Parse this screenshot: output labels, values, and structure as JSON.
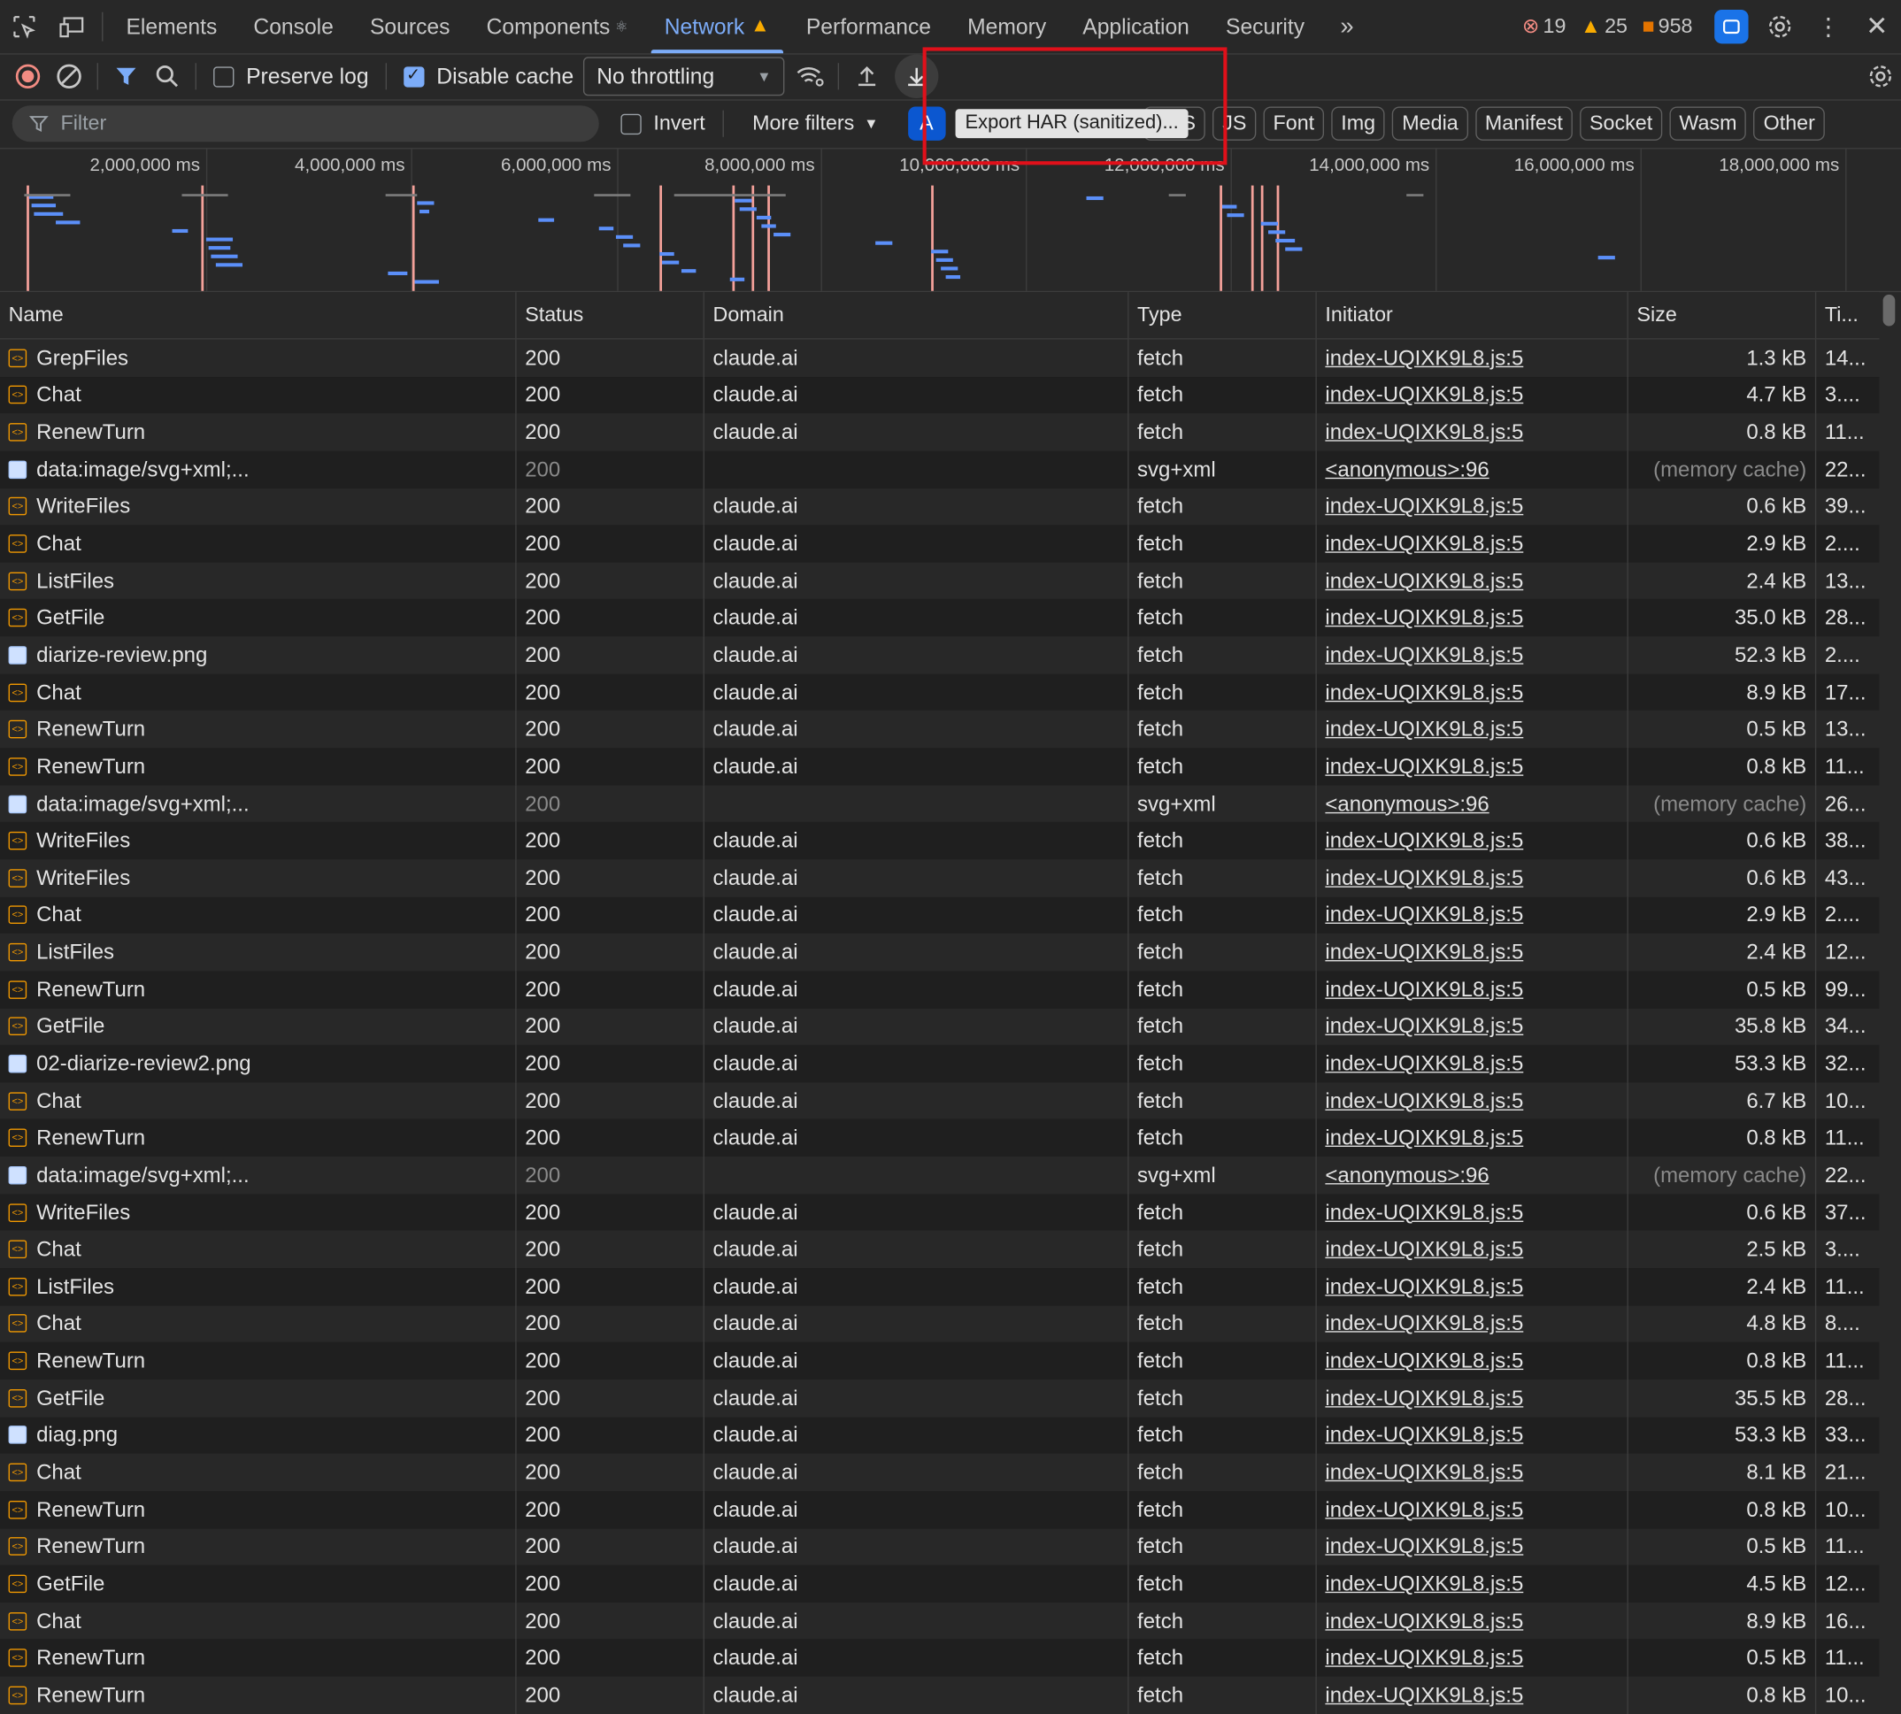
{
  "tabs": [
    {
      "label": "Elements"
    },
    {
      "label": "Console"
    },
    {
      "label": "Sources"
    },
    {
      "label": "Components"
    },
    {
      "label": "Network",
      "active": true
    },
    {
      "label": "Performance"
    },
    {
      "label": "Memory"
    },
    {
      "label": "Application"
    },
    {
      "label": "Security"
    }
  ],
  "badges": {
    "errors": "19",
    "warnings": "25",
    "issues": "958"
  },
  "toolbar": {
    "preserve_log": "Preserve log",
    "disable_cache": "Disable cache",
    "throttling": "No throttling"
  },
  "filter": {
    "placeholder": "Filter",
    "invert": "Invert",
    "more_filters": "More filters",
    "chips": [
      "A",
      "CSS",
      "JS",
      "Font",
      "Img",
      "Media",
      "Manifest",
      "Socket",
      "Wasm",
      "Other"
    ]
  },
  "tooltip": "Export HAR (sanitized)...",
  "overview": {
    "ticks": [
      "2,000,000 ms",
      "4,000,000 ms",
      "6,000,000 ms",
      "8,000,000 ms",
      "10,000,000 ms",
      "12,000,000 ms",
      "14,000,000 ms",
      "16,000,000 ms",
      "18,000,000 ms"
    ]
  },
  "columns": [
    "Name",
    "Status",
    "Domain",
    "Type",
    "Initiator",
    "Size",
    "Ti..."
  ],
  "rows": [
    {
      "icon": "fetch",
      "name": "GrepFiles",
      "status": "200",
      "domain": "claude.ai",
      "type": "fetch",
      "initiator": "index-UQIXK9L8.js:5",
      "size": "1.3 kB",
      "time": "14..."
    },
    {
      "icon": "fetch",
      "name": "Chat",
      "status": "200",
      "domain": "claude.ai",
      "type": "fetch",
      "initiator": "index-UQIXK9L8.js:5",
      "size": "4.7 kB",
      "time": "3...."
    },
    {
      "icon": "fetch",
      "name": "RenewTurn",
      "status": "200",
      "domain": "claude.ai",
      "type": "fetch",
      "initiator": "index-UQIXK9L8.js:5",
      "size": "0.8 kB",
      "time": "11..."
    },
    {
      "icon": "img",
      "name": "data:image/svg+xml;...",
      "status": "200",
      "domain": "",
      "type": "svg+xml",
      "initiator": "<anonymous>:96",
      "size": "(memory cache)",
      "time": "22...",
      "muted": true
    },
    {
      "icon": "fetch",
      "name": "WriteFiles",
      "status": "200",
      "domain": "claude.ai",
      "type": "fetch",
      "initiator": "index-UQIXK9L8.js:5",
      "size": "0.6 kB",
      "time": "39..."
    },
    {
      "icon": "fetch",
      "name": "Chat",
      "status": "200",
      "domain": "claude.ai",
      "type": "fetch",
      "initiator": "index-UQIXK9L8.js:5",
      "size": "2.9 kB",
      "time": "2...."
    },
    {
      "icon": "fetch",
      "name": "ListFiles",
      "status": "200",
      "domain": "claude.ai",
      "type": "fetch",
      "initiator": "index-UQIXK9L8.js:5",
      "size": "2.4 kB",
      "time": "13..."
    },
    {
      "icon": "fetch",
      "name": "GetFile",
      "status": "200",
      "domain": "claude.ai",
      "type": "fetch",
      "initiator": "index-UQIXK9L8.js:5",
      "size": "35.0 kB",
      "time": "28..."
    },
    {
      "icon": "img",
      "name": "diarize-review.png",
      "status": "200",
      "domain": "claude.ai",
      "type": "fetch",
      "initiator": "index-UQIXK9L8.js:5",
      "size": "52.3 kB",
      "time": "2...."
    },
    {
      "icon": "fetch",
      "name": "Chat",
      "status": "200",
      "domain": "claude.ai",
      "type": "fetch",
      "initiator": "index-UQIXK9L8.js:5",
      "size": "8.9 kB",
      "time": "17..."
    },
    {
      "icon": "fetch",
      "name": "RenewTurn",
      "status": "200",
      "domain": "claude.ai",
      "type": "fetch",
      "initiator": "index-UQIXK9L8.js:5",
      "size": "0.5 kB",
      "time": "13..."
    },
    {
      "icon": "fetch",
      "name": "RenewTurn",
      "status": "200",
      "domain": "claude.ai",
      "type": "fetch",
      "initiator": "index-UQIXK9L8.js:5",
      "size": "0.8 kB",
      "time": "11..."
    },
    {
      "icon": "img",
      "name": "data:image/svg+xml;...",
      "status": "200",
      "domain": "",
      "type": "svg+xml",
      "initiator": "<anonymous>:96",
      "size": "(memory cache)",
      "time": "26...",
      "muted": true
    },
    {
      "icon": "fetch",
      "name": "WriteFiles",
      "status": "200",
      "domain": "claude.ai",
      "type": "fetch",
      "initiator": "index-UQIXK9L8.js:5",
      "size": "0.6 kB",
      "time": "38..."
    },
    {
      "icon": "fetch",
      "name": "WriteFiles",
      "status": "200",
      "domain": "claude.ai",
      "type": "fetch",
      "initiator": "index-UQIXK9L8.js:5",
      "size": "0.6 kB",
      "time": "43..."
    },
    {
      "icon": "fetch",
      "name": "Chat",
      "status": "200",
      "domain": "claude.ai",
      "type": "fetch",
      "initiator": "index-UQIXK9L8.js:5",
      "size": "2.9 kB",
      "time": "2...."
    },
    {
      "icon": "fetch",
      "name": "ListFiles",
      "status": "200",
      "domain": "claude.ai",
      "type": "fetch",
      "initiator": "index-UQIXK9L8.js:5",
      "size": "2.4 kB",
      "time": "12..."
    },
    {
      "icon": "fetch",
      "name": "RenewTurn",
      "status": "200",
      "domain": "claude.ai",
      "type": "fetch",
      "initiator": "index-UQIXK9L8.js:5",
      "size": "0.5 kB",
      "time": "99..."
    },
    {
      "icon": "fetch",
      "name": "GetFile",
      "status": "200",
      "domain": "claude.ai",
      "type": "fetch",
      "initiator": "index-UQIXK9L8.js:5",
      "size": "35.8 kB",
      "time": "34..."
    },
    {
      "icon": "img",
      "name": "02-diarize-review2.png",
      "status": "200",
      "domain": "claude.ai",
      "type": "fetch",
      "initiator": "index-UQIXK9L8.js:5",
      "size": "53.3 kB",
      "time": "32..."
    },
    {
      "icon": "fetch",
      "name": "Chat",
      "status": "200",
      "domain": "claude.ai",
      "type": "fetch",
      "initiator": "index-UQIXK9L8.js:5",
      "size": "6.7 kB",
      "time": "10..."
    },
    {
      "icon": "fetch",
      "name": "RenewTurn",
      "status": "200",
      "domain": "claude.ai",
      "type": "fetch",
      "initiator": "index-UQIXK9L8.js:5",
      "size": "0.8 kB",
      "time": "11..."
    },
    {
      "icon": "img",
      "name": "data:image/svg+xml;...",
      "status": "200",
      "domain": "",
      "type": "svg+xml",
      "initiator": "<anonymous>:96",
      "size": "(memory cache)",
      "time": "22...",
      "muted": true
    },
    {
      "icon": "fetch",
      "name": "WriteFiles",
      "status": "200",
      "domain": "claude.ai",
      "type": "fetch",
      "initiator": "index-UQIXK9L8.js:5",
      "size": "0.6 kB",
      "time": "37..."
    },
    {
      "icon": "fetch",
      "name": "Chat",
      "status": "200",
      "domain": "claude.ai",
      "type": "fetch",
      "initiator": "index-UQIXK9L8.js:5",
      "size": "2.5 kB",
      "time": "3...."
    },
    {
      "icon": "fetch",
      "name": "ListFiles",
      "status": "200",
      "domain": "claude.ai",
      "type": "fetch",
      "initiator": "index-UQIXK9L8.js:5",
      "size": "2.4 kB",
      "time": "11..."
    },
    {
      "icon": "fetch",
      "name": "Chat",
      "status": "200",
      "domain": "claude.ai",
      "type": "fetch",
      "initiator": "index-UQIXK9L8.js:5",
      "size": "4.8 kB",
      "time": "8...."
    },
    {
      "icon": "fetch",
      "name": "RenewTurn",
      "status": "200",
      "domain": "claude.ai",
      "type": "fetch",
      "initiator": "index-UQIXK9L8.js:5",
      "size": "0.8 kB",
      "time": "11..."
    },
    {
      "icon": "fetch",
      "name": "GetFile",
      "status": "200",
      "domain": "claude.ai",
      "type": "fetch",
      "initiator": "index-UQIXK9L8.js:5",
      "size": "35.5 kB",
      "time": "28..."
    },
    {
      "icon": "img",
      "name": "diag.png",
      "status": "200",
      "domain": "claude.ai",
      "type": "fetch",
      "initiator": "index-UQIXK9L8.js:5",
      "size": "53.3 kB",
      "time": "33..."
    },
    {
      "icon": "fetch",
      "name": "Chat",
      "status": "200",
      "domain": "claude.ai",
      "type": "fetch",
      "initiator": "index-UQIXK9L8.js:5",
      "size": "8.1 kB",
      "time": "21..."
    },
    {
      "icon": "fetch",
      "name": "RenewTurn",
      "status": "200",
      "domain": "claude.ai",
      "type": "fetch",
      "initiator": "index-UQIXK9L8.js:5",
      "size": "0.8 kB",
      "time": "10..."
    },
    {
      "icon": "fetch",
      "name": "RenewTurn",
      "status": "200",
      "domain": "claude.ai",
      "type": "fetch",
      "initiator": "index-UQIXK9L8.js:5",
      "size": "0.5 kB",
      "time": "11..."
    },
    {
      "icon": "fetch",
      "name": "GetFile",
      "status": "200",
      "domain": "claude.ai",
      "type": "fetch",
      "initiator": "index-UQIXK9L8.js:5",
      "size": "4.5 kB",
      "time": "12..."
    },
    {
      "icon": "fetch",
      "name": "Chat",
      "status": "200",
      "domain": "claude.ai",
      "type": "fetch",
      "initiator": "index-UQIXK9L8.js:5",
      "size": "8.9 kB",
      "time": "16..."
    },
    {
      "icon": "fetch",
      "name": "RenewTurn",
      "status": "200",
      "domain": "claude.ai",
      "type": "fetch",
      "initiator": "index-UQIXK9L8.js:5",
      "size": "0.5 kB",
      "time": "11..."
    },
    {
      "icon": "fetch",
      "name": "RenewTurn",
      "status": "200",
      "domain": "claude.ai",
      "type": "fetch",
      "initiator": "index-UQIXK9L8.js:5",
      "size": "0.8 kB",
      "time": "10..."
    }
  ],
  "colors": {
    "accent": "#7cacf8",
    "highlight_box": "#e0101a"
  }
}
